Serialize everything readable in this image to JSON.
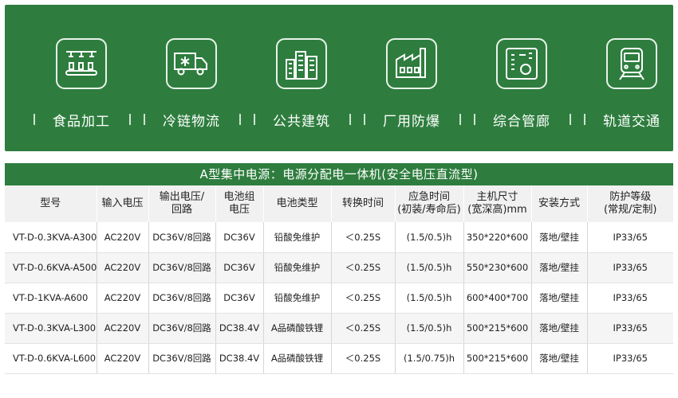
{
  "banner": {
    "apps": [
      {
        "label": "食品加工",
        "icon": "conveyor-icon"
      },
      {
        "label": "冷链物流",
        "icon": "cold-truck-icon"
      },
      {
        "label": "公共建筑",
        "icon": "buildings-icon"
      },
      {
        "label": "厂用防爆",
        "icon": "factory-icon"
      },
      {
        "label": "综合管廊",
        "icon": "control-panel-icon"
      },
      {
        "label": "轨道交通",
        "icon": "train-icon"
      }
    ],
    "color": "#2e7d3e"
  },
  "table": {
    "title": "A型集中电源：电源分配电一体机(安全电压直流型)",
    "headers": [
      {
        "line1": "型号",
        "line2": ""
      },
      {
        "line1": "输入电压",
        "line2": ""
      },
      {
        "line1": "输出电压/",
        "line2": "回路"
      },
      {
        "line1": "电池组",
        "line2": "电压"
      },
      {
        "line1": "电池类型",
        "line2": ""
      },
      {
        "line1": "转换时间",
        "line2": ""
      },
      {
        "line1": "应急时间",
        "line2": "(初装/寿命后)"
      },
      {
        "line1": "主机尺寸",
        "line2": "(宽深高)mm"
      },
      {
        "line1": "安装方式",
        "line2": ""
      },
      {
        "line1": "防护等级",
        "line2": "(常规/定制)"
      }
    ],
    "rows": [
      [
        "VT-D-0.3KVA-A300",
        "AC220V",
        "DC36V/8回路",
        "DC36V",
        "铅酸免维护",
        "＜0.25S",
        "(1.5/0.5)h",
        "350*220*600",
        "落地/壁挂",
        "IP33/65"
      ],
      [
        "VT-D-0.6KVA-A500",
        "AC220V",
        "DC36V/8回路",
        "DC36V",
        "铅酸免维护",
        "＜0.25S",
        "(1.5/0.5)h",
        "550*230*600",
        "落地/壁挂",
        "IP33/65"
      ],
      [
        "VT-D-1KVA-A600",
        "AC220V",
        "DC36V/8回路",
        "DC36V",
        "铅酸免维护",
        "＜0.25S",
        "(1.5/0.5)h",
        "600*400*700",
        "落地/壁挂",
        "IP33/65"
      ],
      [
        "VT-D-0.3KVA-L300",
        "AC220V",
        "DC36V/8回路",
        "DC38.4V",
        "A品磷酸铁锂",
        "＜0.25S",
        "(1.5/0.5)h",
        "500*215*600",
        "落地/壁挂",
        "IP33/65"
      ],
      [
        "VT-D-0.6KVA-L600",
        "AC220V",
        "DC36V/8回路",
        "DC38.4V",
        "A品磷酸铁锂",
        "＜0.25S",
        "(1.5/0.75)h",
        "500*215*600",
        "落地/壁挂",
        "IP33/65"
      ]
    ]
  }
}
